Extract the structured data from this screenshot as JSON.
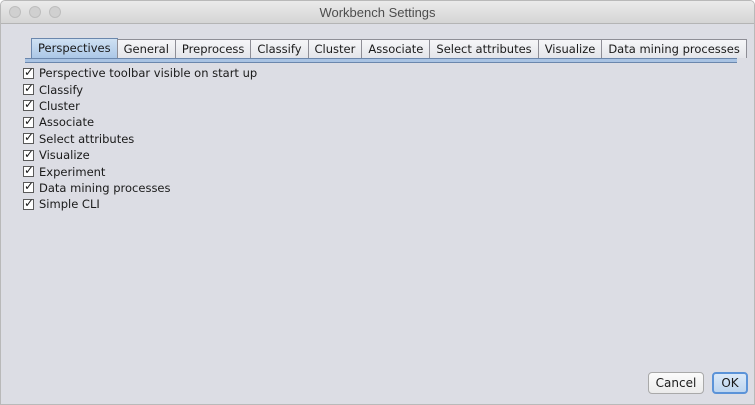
{
  "window": {
    "title": "Workbench Settings"
  },
  "tabs": [
    {
      "label": "Perspectives",
      "active": true
    },
    {
      "label": "General",
      "active": false
    },
    {
      "label": "Preprocess",
      "active": false
    },
    {
      "label": "Classify",
      "active": false
    },
    {
      "label": "Cluster",
      "active": false
    },
    {
      "label": "Associate",
      "active": false
    },
    {
      "label": "Select attributes",
      "active": false
    },
    {
      "label": "Visualize",
      "active": false
    },
    {
      "label": "Data mining processes",
      "active": false
    }
  ],
  "options": [
    {
      "label": "Perspective toolbar visible on start up",
      "checked": true
    },
    {
      "label": "Classify",
      "checked": true
    },
    {
      "label": "Cluster",
      "checked": true
    },
    {
      "label": "Associate",
      "checked": true
    },
    {
      "label": "Select attributes",
      "checked": true
    },
    {
      "label": "Visualize",
      "checked": true
    },
    {
      "label": "Experiment",
      "checked": true
    },
    {
      "label": "Data mining processes",
      "checked": true
    },
    {
      "label": "Simple CLI",
      "checked": true
    }
  ],
  "check_glyph": "✓",
  "buttons": {
    "cancel": "Cancel",
    "ok": "OK"
  },
  "colors": {
    "active_tab": "#a9c6e6",
    "default_button_border": "#5b93d8",
    "window_background": "#dcdde4"
  }
}
